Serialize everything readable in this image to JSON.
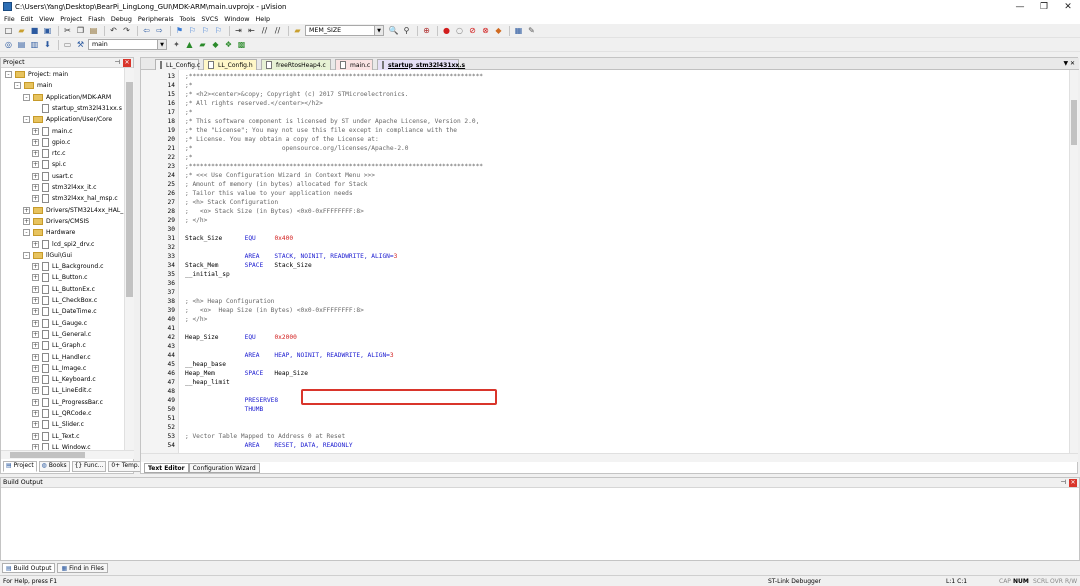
{
  "window": {
    "title": "C:\\Users\\Yang\\Desktop\\BearPi_LingLong_GUI\\MDK-ARM\\main.uvprojx - µVision",
    "minimize": "—",
    "maximize": "❐",
    "close": "✕"
  },
  "menu": [
    "File",
    "Edit",
    "View",
    "Project",
    "Flash",
    "Debug",
    "Peripherals",
    "Tools",
    "SVCS",
    "Window",
    "Help"
  ],
  "toolbar": {
    "find_combo": "MEM_SIZE",
    "target_combo": "main"
  },
  "project_panel": {
    "title": "Project",
    "tree": [
      {
        "label": "Project: main",
        "level": 0,
        "kind": "root",
        "exp": "-"
      },
      {
        "label": "main",
        "level": 1,
        "kind": "folder",
        "exp": "-"
      },
      {
        "label": "Application/MDK-ARM",
        "level": 2,
        "kind": "folder",
        "exp": "-"
      },
      {
        "label": "startup_stm32l431xx.s",
        "level": 3,
        "kind": "file",
        "exp": ""
      },
      {
        "label": "Application/User/Core",
        "level": 2,
        "kind": "folder",
        "exp": "-"
      },
      {
        "label": "main.c",
        "level": 3,
        "kind": "file",
        "exp": "+"
      },
      {
        "label": "gpio.c",
        "level": 3,
        "kind": "file",
        "exp": "+"
      },
      {
        "label": "rtc.c",
        "level": 3,
        "kind": "file",
        "exp": "+"
      },
      {
        "label": "spi.c",
        "level": 3,
        "kind": "file",
        "exp": "+"
      },
      {
        "label": "usart.c",
        "level": 3,
        "kind": "file",
        "exp": "+"
      },
      {
        "label": "stm32l4xx_it.c",
        "level": 3,
        "kind": "file",
        "exp": "+"
      },
      {
        "label": "stm32l4xx_hal_msp.c",
        "level": 3,
        "kind": "file",
        "exp": "+"
      },
      {
        "label": "Drivers/STM32L4xx_HAL_",
        "level": 2,
        "kind": "folder",
        "exp": "+"
      },
      {
        "label": "Drivers/CMSIS",
        "level": 2,
        "kind": "folder",
        "exp": "+"
      },
      {
        "label": "Hardware",
        "level": 2,
        "kind": "folder",
        "exp": "-"
      },
      {
        "label": "lcd_spi2_drv.c",
        "level": 3,
        "kind": "file",
        "exp": "+"
      },
      {
        "label": "llGui\\Gui",
        "level": 2,
        "kind": "folder",
        "exp": "-"
      },
      {
        "label": "LL_Background.c",
        "level": 3,
        "kind": "file",
        "exp": "+"
      },
      {
        "label": "LL_Button.c",
        "level": 3,
        "kind": "file",
        "exp": "+"
      },
      {
        "label": "LL_ButtonEx.c",
        "level": 3,
        "kind": "file",
        "exp": "+"
      },
      {
        "label": "LL_CheckBox.c",
        "level": 3,
        "kind": "file",
        "exp": "+"
      },
      {
        "label": "LL_DateTime.c",
        "level": 3,
        "kind": "file",
        "exp": "+"
      },
      {
        "label": "LL_Gauge.c",
        "level": 3,
        "kind": "file",
        "exp": "+"
      },
      {
        "label": "LL_General.c",
        "level": 3,
        "kind": "file",
        "exp": "+"
      },
      {
        "label": "LL_Graph.c",
        "level": 3,
        "kind": "file",
        "exp": "+"
      },
      {
        "label": "LL_Handler.c",
        "level": 3,
        "kind": "file",
        "exp": "+"
      },
      {
        "label": "LL_Image.c",
        "level": 3,
        "kind": "file",
        "exp": "+"
      },
      {
        "label": "LL_Keyboard.c",
        "level": 3,
        "kind": "file",
        "exp": "+"
      },
      {
        "label": "LL_LineEdit.c",
        "level": 3,
        "kind": "file",
        "exp": "+"
      },
      {
        "label": "LL_ProgressBar.c",
        "level": 3,
        "kind": "file",
        "exp": "+"
      },
      {
        "label": "LL_QRCode.c",
        "level": 3,
        "kind": "file",
        "exp": "+"
      },
      {
        "label": "LL_Slider.c",
        "level": 3,
        "kind": "file",
        "exp": "+"
      },
      {
        "label": "LL_Text.c",
        "level": 3,
        "kind": "file",
        "exp": "+"
      },
      {
        "label": "LL_Window.c",
        "level": 3,
        "kind": "file",
        "exp": "+"
      }
    ],
    "tabs": [
      "Project",
      "Books",
      "{} Func...",
      "0+ Temp..."
    ]
  },
  "editor": {
    "file_tabs": [
      {
        "label": "LL_Config.c",
        "color": "#f3f3f3"
      },
      {
        "label": "LL_Config.h",
        "color": "#fff7c8"
      },
      {
        "label": "freeRtosHeap4.c",
        "color": "#e7f2d5"
      },
      {
        "label": "main.c",
        "color": "#fbe3e3"
      },
      {
        "label": "startup_stm32l431xx.s",
        "color": "#e6e0f7",
        "active": true
      }
    ],
    "lines": [
      {
        "n": "13",
        "parts": [
          [
            "cm",
            ";*******************************************************************************"
          ]
        ]
      },
      {
        "n": "14",
        "parts": [
          [
            "cm",
            ";*"
          ]
        ]
      },
      {
        "n": "15",
        "parts": [
          [
            "cm",
            ";* <h2><center>&copy; Copyright (c) 2017 STMicroelectronics."
          ]
        ]
      },
      {
        "n": "16",
        "parts": [
          [
            "cm",
            ";* All rights reserved.</center></h2>"
          ]
        ]
      },
      {
        "n": "17",
        "parts": [
          [
            "cm",
            ";*"
          ]
        ]
      },
      {
        "n": "18",
        "parts": [
          [
            "cm",
            ";* This software component is licensed by ST under Apache License, Version 2.0,"
          ]
        ]
      },
      {
        "n": "19",
        "parts": [
          [
            "cm",
            ";* the \"License\"; You may not use this file except in compliance with the"
          ]
        ]
      },
      {
        "n": "20",
        "parts": [
          [
            "cm",
            ";* License. You may obtain a copy of the License at:"
          ]
        ]
      },
      {
        "n": "21",
        "parts": [
          [
            "cm",
            ";*                        opensource.org/licenses/Apache-2.0"
          ]
        ]
      },
      {
        "n": "22",
        "parts": [
          [
            "cm",
            ";*"
          ]
        ]
      },
      {
        "n": "23",
        "parts": [
          [
            "cm",
            ";*******************************************************************************"
          ]
        ]
      },
      {
        "n": "24",
        "parts": [
          [
            "cm",
            ";* <<< Use Configuration Wizard in Context Menu >>>"
          ]
        ]
      },
      {
        "n": "25",
        "parts": [
          [
            "cm",
            "; Amount of memory (in bytes) allocated for Stack"
          ]
        ]
      },
      {
        "n": "26",
        "parts": [
          [
            "cm",
            "; Tailor this value to your application needs"
          ]
        ]
      },
      {
        "n": "27",
        "parts": [
          [
            "cm",
            "; <h> Stack Configuration"
          ]
        ]
      },
      {
        "n": "28",
        "parts": [
          [
            "cm",
            ";   <o> Stack Size (in Bytes) <0x0-0xFFFFFFFF:8>"
          ]
        ]
      },
      {
        "n": "29",
        "parts": [
          [
            "cm",
            "; </h>"
          ]
        ]
      },
      {
        "n": "30",
        "parts": [
          [
            "tx",
            ""
          ]
        ]
      },
      {
        "n": "31",
        "parts": [
          [
            "tx",
            "Stack_Size      "
          ],
          [
            "kw",
            "EQU"
          ],
          [
            "tx",
            "     "
          ],
          [
            "nm",
            "0x400"
          ]
        ]
      },
      {
        "n": "32",
        "parts": [
          [
            "tx",
            ""
          ]
        ]
      },
      {
        "n": "33",
        "parts": [
          [
            "tx",
            "                "
          ],
          [
            "kw",
            "AREA"
          ],
          [
            "tx",
            "    "
          ],
          [
            "kw",
            "STACK, NOINIT, READWRITE, ALIGN="
          ],
          [
            "nm",
            "3"
          ]
        ]
      },
      {
        "n": "34",
        "parts": [
          [
            "tx",
            "Stack_Mem       "
          ],
          [
            "kw",
            "SPACE"
          ],
          [
            "tx",
            "   Stack_Size"
          ]
        ]
      },
      {
        "n": "35",
        "parts": [
          [
            "tx",
            "__initial_sp"
          ]
        ]
      },
      {
        "n": "36",
        "parts": [
          [
            "tx",
            ""
          ]
        ]
      },
      {
        "n": "37",
        "parts": [
          [
            "tx",
            ""
          ]
        ]
      },
      {
        "n": "38",
        "parts": [
          [
            "cm",
            "; <h> Heap Configuration"
          ]
        ]
      },
      {
        "n": "39",
        "parts": [
          [
            "cm",
            ";   <o>  Heap Size (in Bytes) <0x0-0xFFFFFFFF:8>"
          ]
        ]
      },
      {
        "n": "40",
        "parts": [
          [
            "cm",
            "; </h>"
          ]
        ]
      },
      {
        "n": "41",
        "parts": [
          [
            "tx",
            ""
          ]
        ]
      },
      {
        "n": "42",
        "parts": [
          [
            "tx",
            "Heap_Size       "
          ],
          [
            "kw",
            "EQU"
          ],
          [
            "tx",
            "     "
          ],
          [
            "nm",
            "0x2000"
          ]
        ]
      },
      {
        "n": "43",
        "parts": [
          [
            "tx",
            ""
          ]
        ]
      },
      {
        "n": "44",
        "parts": [
          [
            "tx",
            "                "
          ],
          [
            "kw",
            "AREA"
          ],
          [
            "tx",
            "    "
          ],
          [
            "kw",
            "HEAP, NOINIT, READWRITE, ALIGN="
          ],
          [
            "nm",
            "3"
          ]
        ]
      },
      {
        "n": "45",
        "parts": [
          [
            "tx",
            "__heap_base"
          ]
        ]
      },
      {
        "n": "46",
        "parts": [
          [
            "tx",
            "Heap_Mem        "
          ],
          [
            "kw",
            "SPACE"
          ],
          [
            "tx",
            "   Heap_Size"
          ]
        ]
      },
      {
        "n": "47",
        "parts": [
          [
            "tx",
            "__heap_limit"
          ]
        ]
      },
      {
        "n": "48",
        "parts": [
          [
            "tx",
            ""
          ]
        ]
      },
      {
        "n": "49",
        "parts": [
          [
            "tx",
            "                "
          ],
          [
            "kw",
            "PRESERVE8"
          ]
        ]
      },
      {
        "n": "50",
        "parts": [
          [
            "tx",
            "                "
          ],
          [
            "kw",
            "THUMB"
          ]
        ]
      },
      {
        "n": "51",
        "parts": [
          [
            "tx",
            ""
          ]
        ]
      },
      {
        "n": "52",
        "parts": [
          [
            "tx",
            ""
          ]
        ]
      },
      {
        "n": "53",
        "parts": [
          [
            "cm",
            "; Vector Table Mapped to Address 0 at Reset"
          ]
        ]
      },
      {
        "n": "54",
        "parts": [
          [
            "tx",
            "                "
          ],
          [
            "kw",
            "AREA"
          ],
          [
            "tx",
            "    "
          ],
          [
            "kw",
            "RESET, DATA, READONLY"
          ]
        ]
      }
    ],
    "bottom_tabs": [
      "Text Editor",
      "Configuration Wizard"
    ]
  },
  "build_output": {
    "title": "Build Output",
    "tabs": [
      "Build Output",
      "Find in Files"
    ]
  },
  "status": {
    "help": "For Help, press F1",
    "debugger": "ST-Link Debugger",
    "position": "L:1 C:1",
    "cap": "CAP",
    "num": "NUM",
    "scrl": "SCRL",
    "ovr": "OVR",
    "rw": "R/W"
  }
}
